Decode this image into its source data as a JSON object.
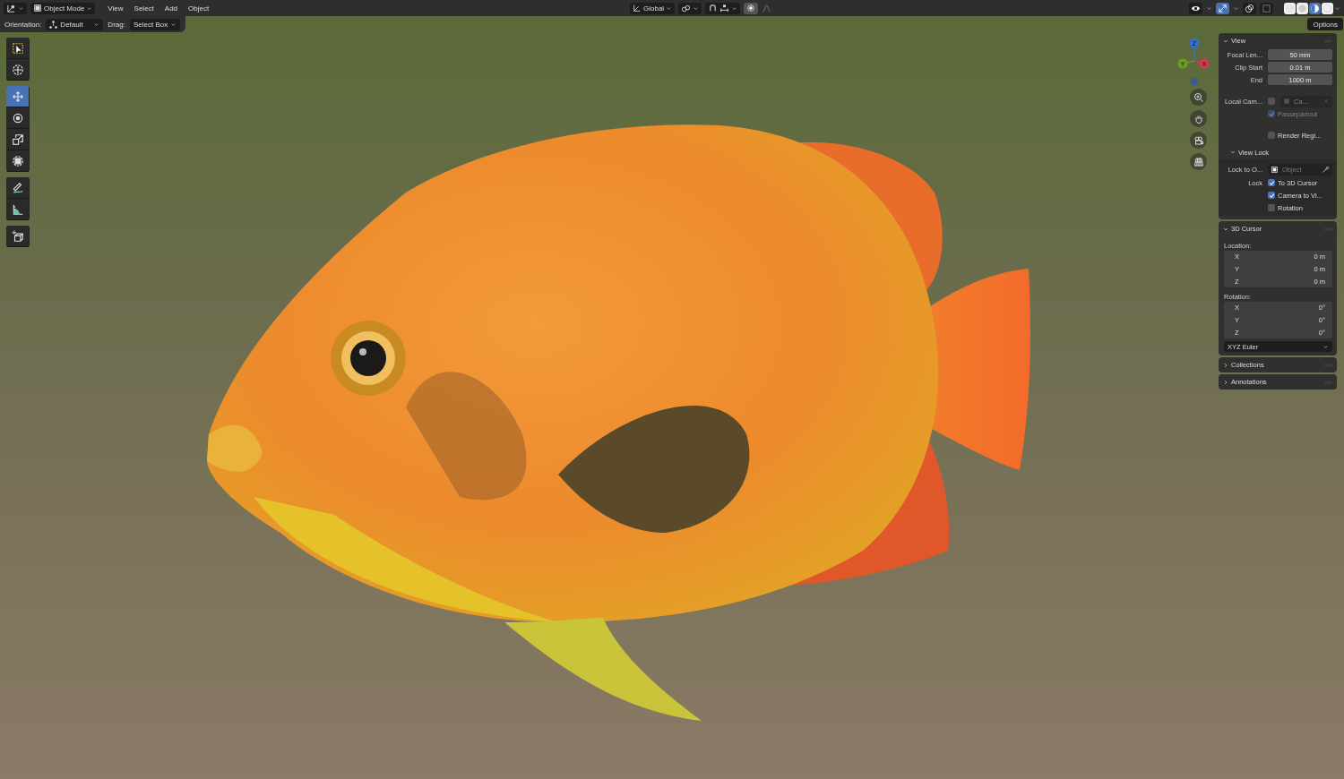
{
  "header": {
    "mode": "Object Mode",
    "menus": [
      "View",
      "Select",
      "Add",
      "Object"
    ],
    "orientation": "Global",
    "toggles": [
      {
        "kind": "visibility",
        "on": false
      },
      {
        "kind": "gizmos",
        "on": true
      },
      {
        "kind": "overlays",
        "on": false
      },
      {
        "kind": "xray",
        "on": false
      }
    ],
    "shading": [
      {
        "kind": "wireframe",
        "selected": false
      },
      {
        "kind": "solid",
        "selected": false
      },
      {
        "kind": "material",
        "selected": true
      },
      {
        "kind": "rendered",
        "selected": false
      }
    ]
  },
  "tool_settings": {
    "orientation_label": "Orientation:",
    "orientation": "Default",
    "drag_label": "Drag:",
    "drag": "Select Box",
    "options": "Options"
  },
  "toolbar": {
    "groups": [
      {
        "tools": [
          {
            "kind": "select_box",
            "selected": false
          },
          {
            "kind": "cursor",
            "selected": false
          }
        ]
      },
      {
        "tools": [
          {
            "kind": "move",
            "selected": true
          },
          {
            "kind": "rotate",
            "selected": false
          },
          {
            "kind": "scale",
            "selected": false
          },
          {
            "kind": "transform",
            "selected": false
          }
        ]
      },
      {
        "tools": [
          {
            "kind": "annotate",
            "selected": false
          },
          {
            "kind": "measure",
            "selected": false
          }
        ]
      },
      {
        "tools": [
          {
            "kind": "add_cube",
            "selected": false
          }
        ]
      }
    ]
  },
  "navigation_gizmo": {
    "axes": [
      {
        "label": "Z",
        "color": "#2f6fd6"
      },
      {
        "label": "Y",
        "color": "#6c9c22"
      },
      {
        "label": "X",
        "color": "#d63a50"
      }
    ]
  },
  "sidebar": {
    "panels": [
      {
        "title": "View",
        "expanded": true,
        "rows": [
          {
            "kind": "field",
            "label": "Focal Len...",
            "value": "50 mm"
          },
          {
            "kind": "field",
            "label": "Clip Start",
            "value": "0.01 m"
          },
          {
            "kind": "field",
            "label": "End",
            "value": "1000 m"
          },
          {
            "kind": "camera",
            "label": "Local Cam...",
            "checked": false,
            "value": "Ca..."
          },
          {
            "kind": "checkbox",
            "text": "Passepartout",
            "checked": true,
            "disabled": true
          },
          {
            "kind": "checkbox",
            "text": "Render Regi...",
            "checked": false,
            "disabled": false
          },
          {
            "kind": "subpanel",
            "title": "View Lock",
            "expanded": true,
            "rows": [
              {
                "kind": "object",
                "label": "Lock to O...",
                "placeholder": "Object"
              },
              {
                "kind": "checkbox",
                "label": "Lock",
                "text": "To 3D Cursor",
                "checked": true,
                "disabled": false
              },
              {
                "kind": "checkbox",
                "text": "Camera to Vi...",
                "checked": true,
                "disabled": false
              },
              {
                "kind": "checkbox",
                "text": "Rotation",
                "checked": false,
                "disabled": false
              }
            ]
          }
        ]
      },
      {
        "title": "3D Cursor",
        "expanded": true,
        "rows": [
          {
            "kind": "heading",
            "text": "Location:"
          },
          {
            "kind": "vector",
            "items": [
              {
                "axis": "X",
                "value": "0 m"
              },
              {
                "axis": "Y",
                "value": "0 m"
              },
              {
                "axis": "Z",
                "value": "0 m"
              }
            ]
          },
          {
            "kind": "heading",
            "text": "Rotation:"
          },
          {
            "kind": "vector",
            "items": [
              {
                "axis": "X",
                "value": "0°"
              },
              {
                "axis": "Y",
                "value": "0°"
              },
              {
                "axis": "Z",
                "value": "0°"
              }
            ]
          },
          {
            "kind": "dropdown",
            "value": "XYZ Euler"
          }
        ]
      },
      {
        "title": "Collections",
        "expanded": false
      },
      {
        "title": "Annotations",
        "expanded": false
      }
    ]
  }
}
